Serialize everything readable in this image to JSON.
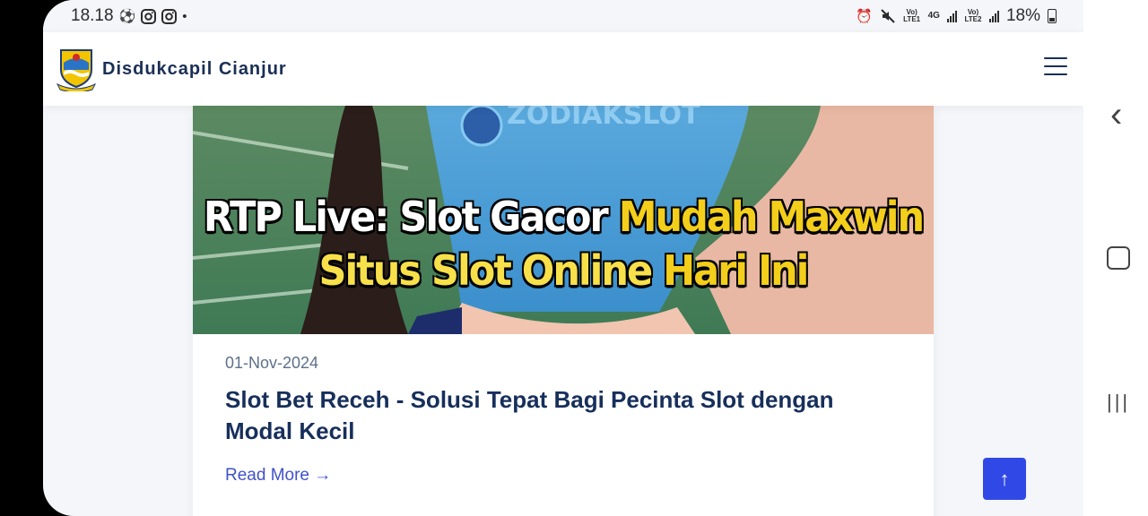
{
  "status_bar": {
    "time": "18.18",
    "battery": "18%",
    "sim1": "Vo) LTE1",
    "sim2": "Vo) LTE2",
    "network": "4G"
  },
  "header": {
    "brand": "Disdukcapil Cianjur",
    "menu_icon": "hamburger-icon"
  },
  "post": {
    "image_headline_line1": [
      "RTP Live: Slot Gacor ",
      "Mudah Maxwin"
    ],
    "image_headline_line2": [
      "Situs Slot Online ",
      "Hari Ini"
    ],
    "image_shirt_text": "ZODIAKSLOT",
    "date": "01-Nov-2024",
    "title": "Slot Bet Receh - Solusi Tepat Bagi Pecinta Slot dengan Modal Kecil",
    "read_more": "Read More →"
  },
  "scroll_top": {
    "label": "↑"
  },
  "android_nav": {
    "back": "‹",
    "home": "▢",
    "recents": "|||"
  },
  "colors": {
    "brand_blue": "#172f5b",
    "accent": "#3049e6",
    "link": "#4052c9",
    "headline_yellow": "#f3ce1b"
  }
}
